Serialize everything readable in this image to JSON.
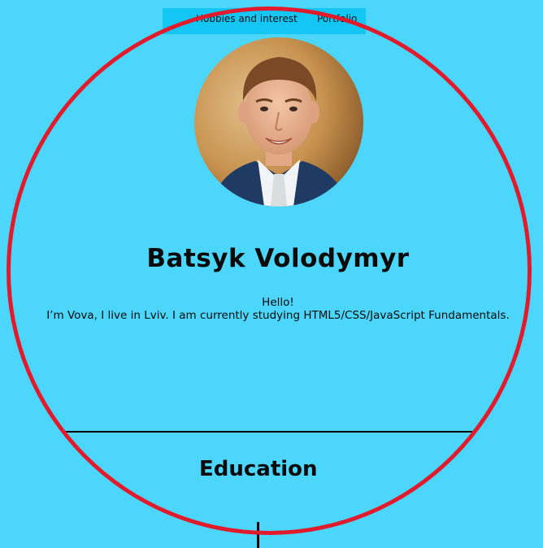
{
  "nav": {
    "items": [
      {
        "label": "Hobbies and interest"
      },
      {
        "label": "Portfolio"
      }
    ]
  },
  "profile": {
    "name": "Batsyk Volodymyr",
    "greeting": "Hello!",
    "intro": "I’m Vova, I live in Lviv. I am currently studying HTML5/CSS/JavaScript Fundamentals."
  },
  "sections": {
    "education_title": "Education"
  },
  "colors": {
    "background": "#4dd6fb",
    "nav_background": "#14c6f3",
    "circle_border": "#e21b2c",
    "text": "#0a0a0a"
  }
}
